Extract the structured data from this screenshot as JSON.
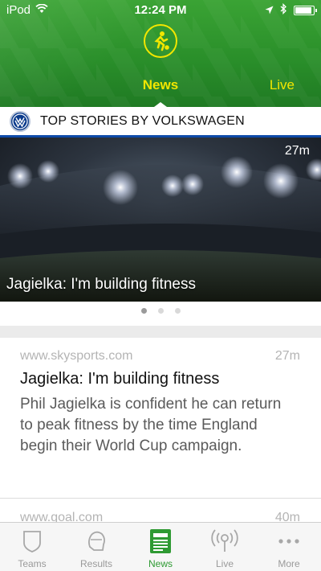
{
  "status_bar": {
    "carrier": "iPod",
    "time": "12:24 PM"
  },
  "header": {
    "tabs": [
      {
        "label": "News",
        "active": true
      },
      {
        "label": "Live",
        "active": false
      }
    ],
    "accent_color": "#f2e600",
    "background_color": "#2a8f2a"
  },
  "sponsor": {
    "logo_icon": "volkswagen-logo-icon",
    "text": "TOP STORIES BY VOLKSWAGEN"
  },
  "hero": {
    "time": "27m",
    "caption": "Jagielka: I'm building fitness",
    "pages": 3,
    "current_page": 1
  },
  "articles": [
    {
      "source": "www.skysports.com",
      "age": "27m",
      "headline": "Jagielka: I'm building fitness",
      "summary": "Phil Jagielka is confident he can return to peak fitness by the time England begin their World Cup campaign."
    },
    {
      "source": "www.goal.com",
      "age": "40m"
    }
  ],
  "tabbar": {
    "items": [
      {
        "label": "Teams",
        "icon": "shield-icon",
        "active": false
      },
      {
        "label": "Results",
        "icon": "head-icon",
        "active": false
      },
      {
        "label": "News",
        "icon": "newspaper-icon",
        "active": true
      },
      {
        "label": "Live",
        "icon": "broadcast-icon",
        "active": false
      },
      {
        "label": "More",
        "icon": "ellipsis-icon",
        "active": false
      }
    ],
    "active_color": "#2f9a33"
  }
}
